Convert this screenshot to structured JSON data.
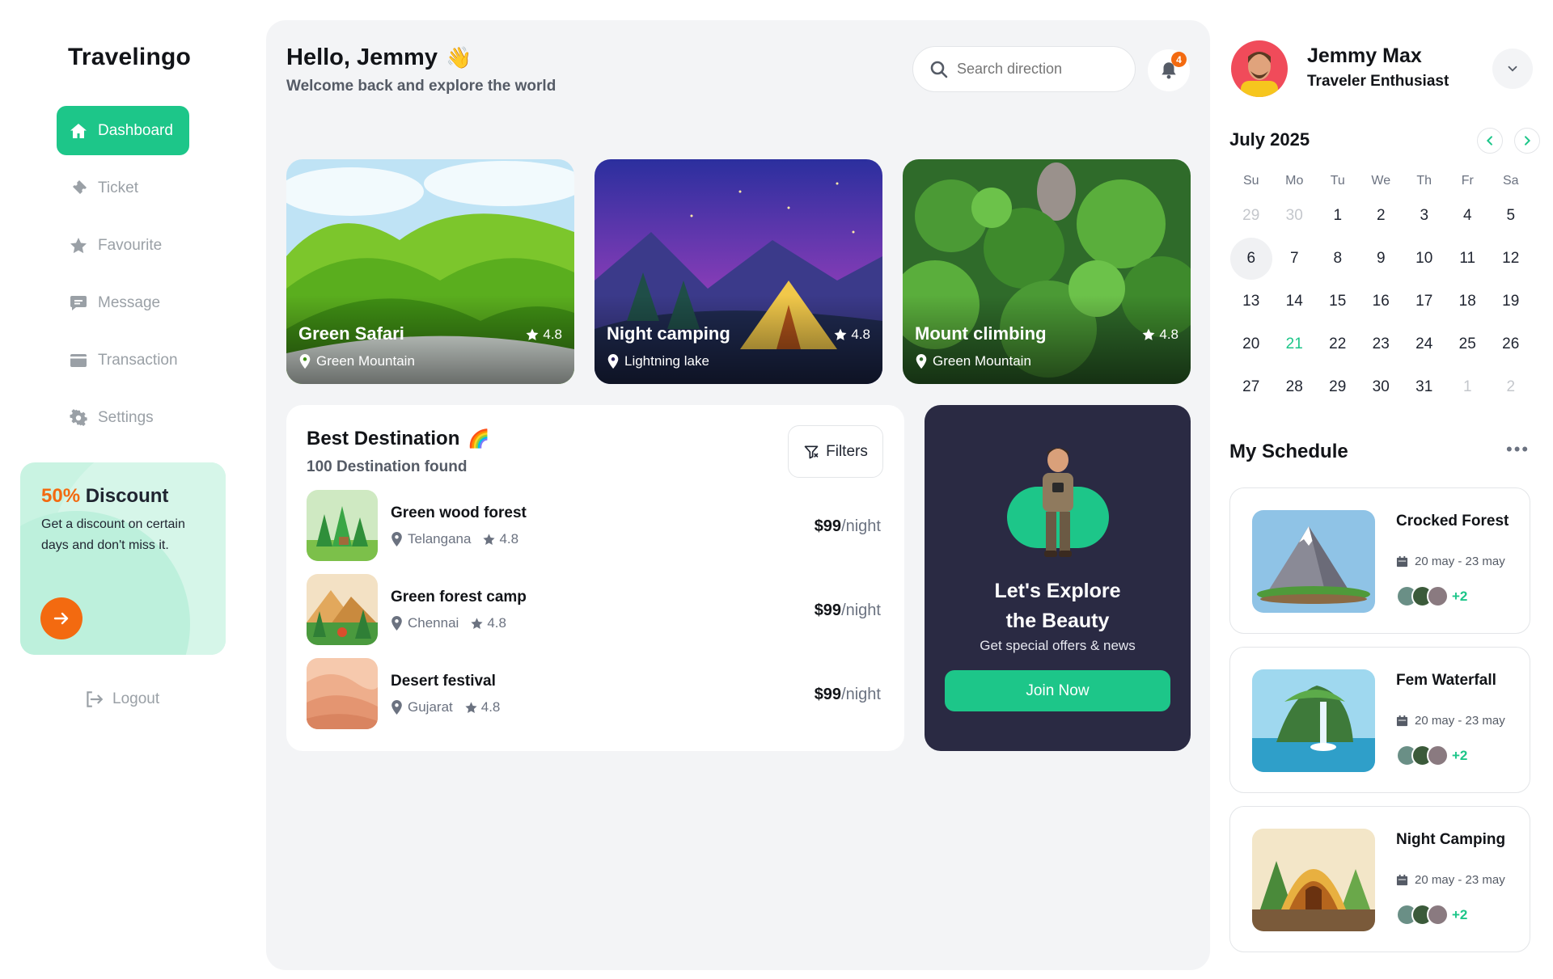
{
  "app": {
    "logo": "Travelingo"
  },
  "sidebar": {
    "items": [
      {
        "label": "Dashboard",
        "icon": "home-icon",
        "active": true
      },
      {
        "label": "Ticket",
        "icon": "ticket-icon"
      },
      {
        "label": "Favourite",
        "icon": "star-icon"
      },
      {
        "label": "Message",
        "icon": "message-icon"
      },
      {
        "label": "Transaction",
        "icon": "wallet-icon"
      },
      {
        "label": "Settings",
        "icon": "gear-icon"
      }
    ],
    "discount": {
      "percent": "50%",
      "title": "Discount",
      "text": "Get a discount on certain days and don't miss it.",
      "button_icon": "arrow-right-icon"
    },
    "logout": "Logout"
  },
  "header": {
    "greeting": "Hello, Jemmy",
    "wave": "👋",
    "subtitle": "Welcome back and explore the world",
    "search_placeholder": "Search direction",
    "notification_count": "4"
  },
  "featured": [
    {
      "title": "Green Safari",
      "location": "Green Mountain",
      "rating": "4.8"
    },
    {
      "title": "Night camping",
      "location": "Lightning lake",
      "rating": "4.8"
    },
    {
      "title": "Mount climbing",
      "location": "Green Mountain",
      "rating": "4.8"
    }
  ],
  "best_destination": {
    "title": "Best Destination",
    "emoji": "🌈",
    "subtitle": "100 Destination found",
    "filters_label": "Filters",
    "items": [
      {
        "name": "Green wood forest",
        "location": "Telangana",
        "rating": "4.8",
        "price": "$99",
        "unit": "/night"
      },
      {
        "name": "Green forest camp",
        "location": "Chennai",
        "rating": "4.8",
        "price": "$99",
        "unit": "/night"
      },
      {
        "name": "Desert festival",
        "location": "Gujarat",
        "rating": "4.8",
        "price": "$99",
        "unit": "/night"
      }
    ]
  },
  "promo": {
    "title_line1": "Let's Explore",
    "title_line2": "the Beauty",
    "subtitle": "Get special offers & news",
    "button": "Join Now"
  },
  "user": {
    "name": "Jemmy Max",
    "role": "Traveler Enthusiast"
  },
  "calendar": {
    "month": "July 2025",
    "weekdays": [
      "Su",
      "Mo",
      "Tu",
      "We",
      "Th",
      "Fr",
      "Sa"
    ],
    "weeks": [
      [
        "29",
        "30",
        "1",
        "2",
        "3",
        "4",
        "5"
      ],
      [
        "6",
        "7",
        "8",
        "9",
        "10",
        "11",
        "12"
      ],
      [
        "13",
        "14",
        "15",
        "16",
        "17",
        "18",
        "19"
      ],
      [
        "20",
        "21",
        "22",
        "23",
        "24",
        "25",
        "26"
      ],
      [
        "27",
        "28",
        "29",
        "30",
        "31",
        "1",
        "2"
      ]
    ],
    "selected": "6",
    "today": "21"
  },
  "schedule": {
    "title": "My Schedule",
    "more": "•••",
    "items": [
      {
        "name": "Crocked Forest",
        "dates": "20 may - 23 may",
        "extra": "+2"
      },
      {
        "name": "Fem Waterfall",
        "dates": "20 may - 23 may",
        "extra": "+2"
      },
      {
        "name": "Night Camping",
        "dates": "20 may - 23 may",
        "extra": "+2"
      }
    ]
  },
  "colors": {
    "accent": "#1dc689",
    "orange": "#f36a10",
    "dark": "#2a2a43",
    "panel": "#f3f4f6"
  }
}
